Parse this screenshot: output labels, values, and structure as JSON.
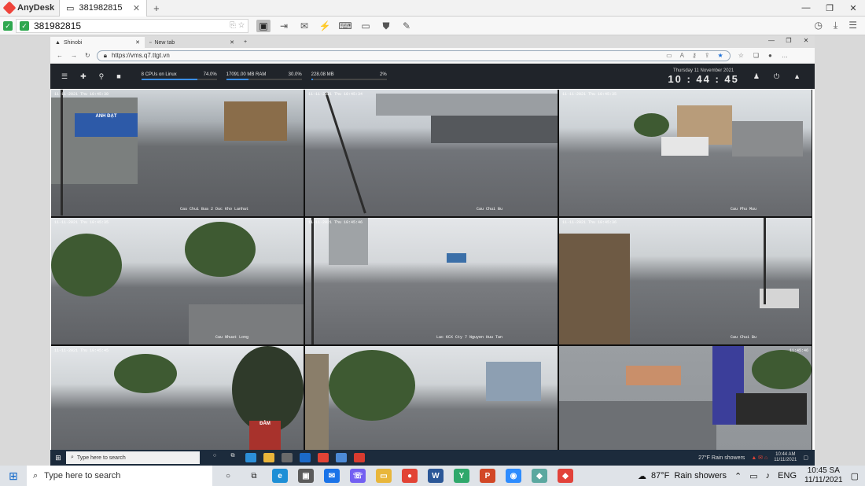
{
  "anydesk": {
    "brand": "AnyDesk",
    "tab_label": "381982815",
    "address_value": "381982815"
  },
  "remote_browser": {
    "tabs": [
      {
        "label": "Shinobi"
      },
      {
        "label": "New tab"
      }
    ],
    "url": "https://vms.q7.ttgt.vn"
  },
  "shinobi": {
    "stats": [
      {
        "label": "8 CPUs on Linux",
        "value": "74.0%",
        "fill": 0.74
      },
      {
        "label": "17091.00 MB RAM",
        "value": "30.0%",
        "fill": 0.3
      },
      {
        "label": "228.08 MB",
        "value": "2%",
        "fill": 0.02
      }
    ],
    "date": "Thursday 11 November 2021",
    "time": "10 : 44 : 45"
  },
  "cameras": [
    {
      "timestamp": "11-11-2021 Thu 10:45:30",
      "name": "Cau Chui Bua 2 Duc Kho Lanhat"
    },
    {
      "timestamp": "11-11-2021 Thu 10:45:34",
      "name": "Cau Chui Bu"
    },
    {
      "timestamp": "11-11-2021 Thu 10:45:35",
      "name": "Cau Phu Muu"
    },
    {
      "timestamp": "11-11-2021 Thu 10:45:35",
      "name": "Cau Nhuat Long"
    },
    {
      "timestamp": "11-11-2021 Thu 10:45:46",
      "name": "Lac KCX Cty 7 Nguyen Huu Tan"
    },
    {
      "timestamp": "11-11-2021 Thu 10:45:36",
      "name": "Cau Chui Bu"
    },
    {
      "timestamp": "11-11-2021 Thu 10:45:45",
      "name": ""
    },
    {
      "timestamp": "",
      "name": ""
    },
    {
      "timestamp": "11:45:46",
      "name": ""
    }
  ],
  "remote_taskbar": {
    "search_placeholder": "Type here to search",
    "weather": "27°F  Rain showers",
    "time": "10:44 AM",
    "date": "11/11/2021"
  },
  "taskbar": {
    "search_placeholder": "Type here to search",
    "weather_temp": "87°F",
    "weather_desc": "Rain showers",
    "language": "ENG",
    "time": "10:45 SA",
    "date": "11/11/2021"
  }
}
